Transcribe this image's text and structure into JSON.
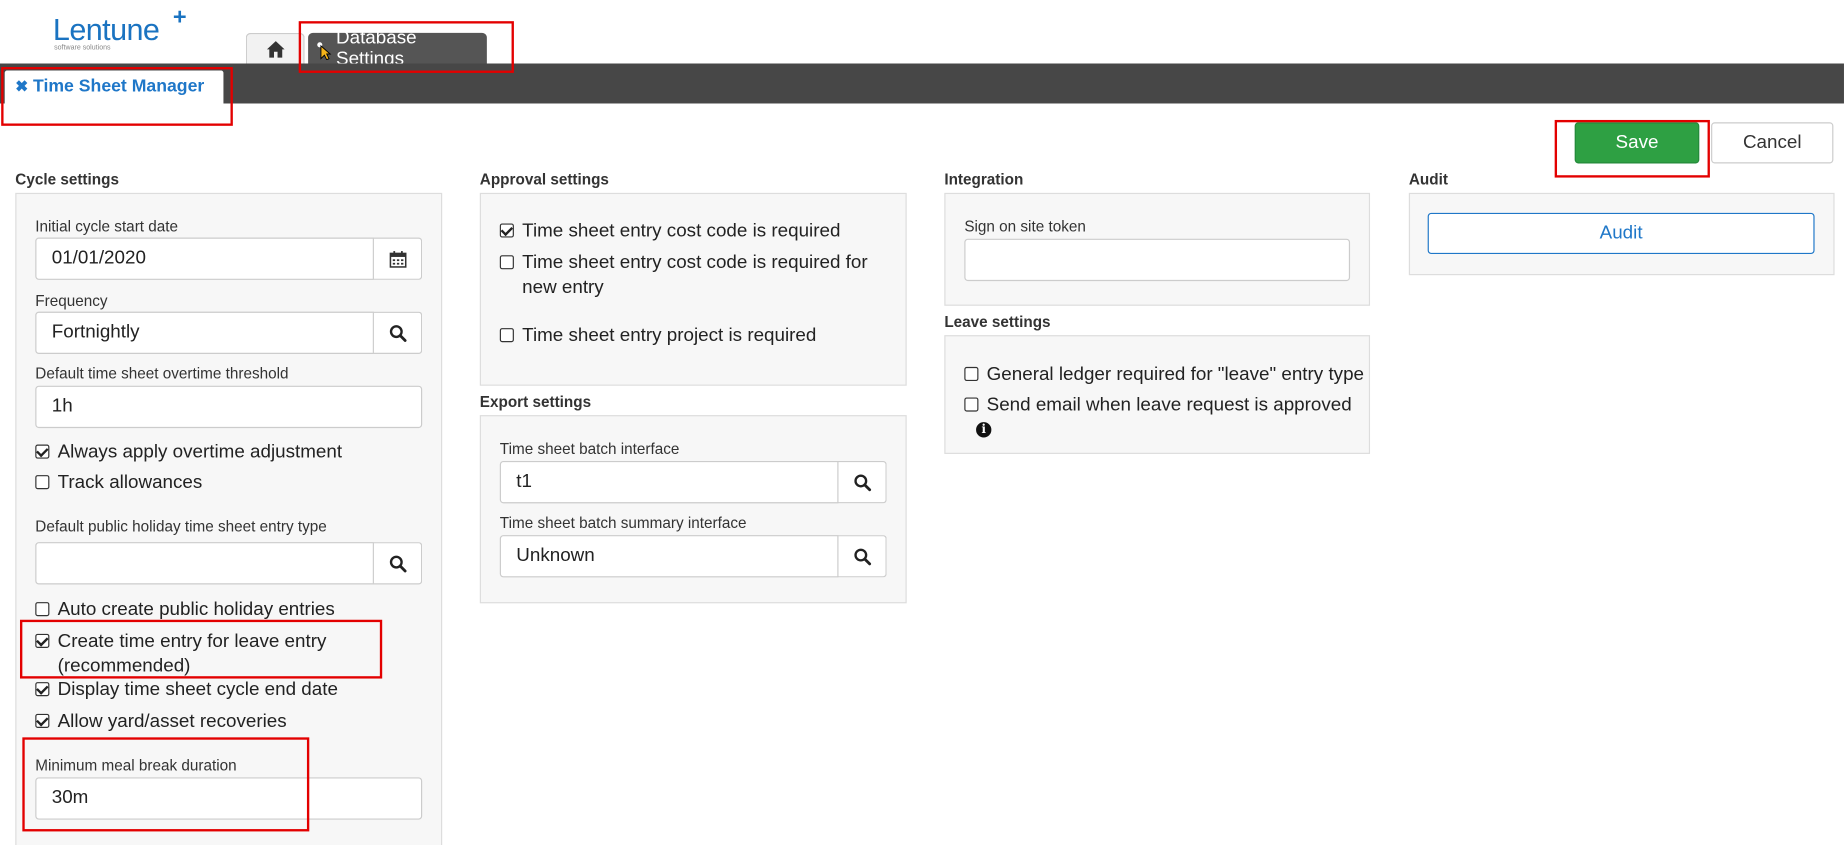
{
  "brand": {
    "name": "Lentune",
    "plus": "+",
    "tagline": "software solutions"
  },
  "nav": {
    "home_icon": "home-icon",
    "db_tab_label": "Database Settings"
  },
  "active_tab": {
    "close_glyph": "✖",
    "label": "Time Sheet Manager"
  },
  "toolbar": {
    "save_label": "Save",
    "cancel_label": "Cancel"
  },
  "cycle": {
    "title": "Cycle settings",
    "start_date_label": "Initial cycle start date",
    "start_date_value": "01/01/2020",
    "frequency_label": "Frequency",
    "frequency_value": "Fortnightly",
    "overtime_label": "Default time sheet overtime threshold",
    "overtime_value": "1h",
    "always_apply_overtime": "Always apply overtime adjustment",
    "track_allowances": "Track allowances",
    "holiday_type_label": "Default public holiday time sheet entry type",
    "holiday_type_value": "",
    "auto_create_holiday": "Auto create public holiday entries",
    "create_time_entry": "Create time entry for leave entry (recommended)",
    "display_cycle_end": "Display time sheet cycle end date",
    "allow_yard": "Allow yard/asset recoveries",
    "meal_break_label": "Minimum meal break duration",
    "meal_break_value": "30m"
  },
  "approval": {
    "title": "Approval settings",
    "cost_code_required": "Time sheet entry cost code is required",
    "cost_code_new": "Time sheet entry cost code is required for new entry",
    "project_required": "Time sheet entry project is required"
  },
  "export": {
    "title": "Export settings",
    "batch_label": "Time sheet batch interface",
    "batch_value": "t1",
    "summary_label": "Time sheet batch summary interface",
    "summary_value": "Unknown"
  },
  "integration": {
    "title": "Integration",
    "token_label": "Sign on site token",
    "token_value": ""
  },
  "leave": {
    "title": "Leave settings",
    "gl_required": "General ledger required for \"leave\" entry type",
    "send_email": "Send email when leave request is approved",
    "info_glyph": "i"
  },
  "audit": {
    "title": "Audit",
    "button_label": "Audit"
  },
  "colors": {
    "accent": "#1f77c8",
    "save_green": "#2ea043",
    "highlight_red": "#e30000",
    "bar_dark": "#474747"
  }
}
